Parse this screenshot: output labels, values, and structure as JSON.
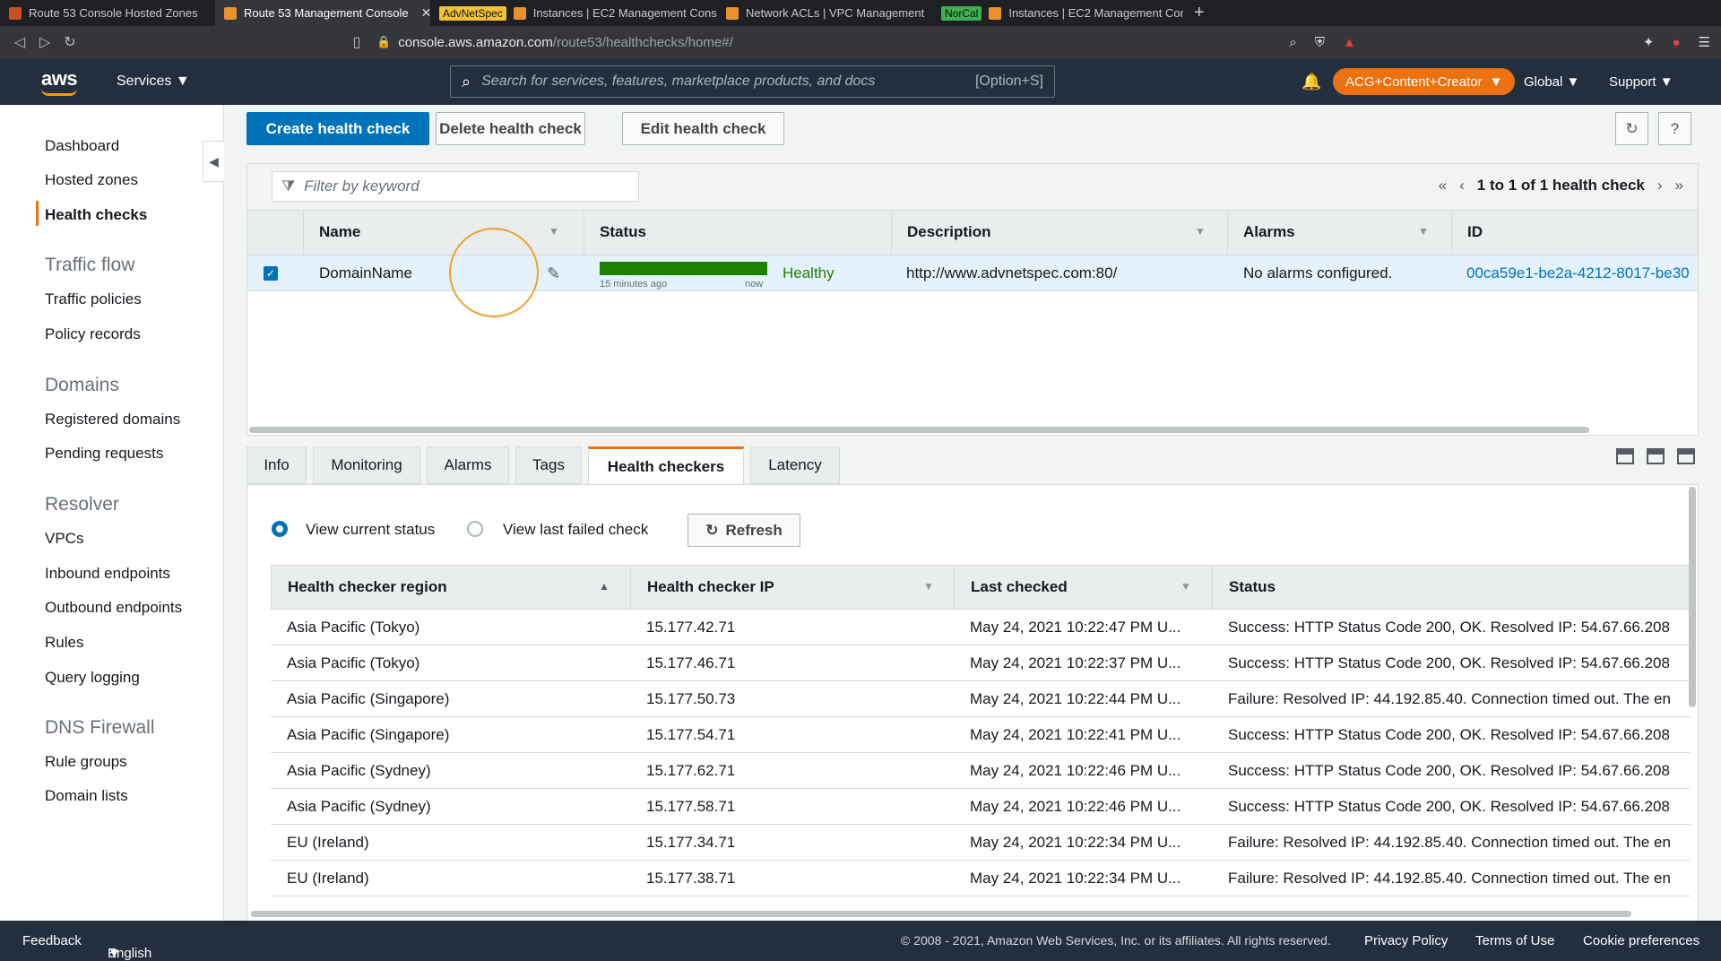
{
  "browser": {
    "tabs": [
      {
        "label": "Route 53 Console Hosted Zones",
        "tag": ""
      },
      {
        "label": "Route 53 Management Console",
        "tag": ""
      },
      {
        "label": "Instances | EC2 Management Cons",
        "tag": "AdvNetSpec"
      },
      {
        "label": "Network ACLs | VPC Management",
        "tag": ""
      },
      {
        "label": "Instances | EC2 Management Cons",
        "tag": "NorCal"
      }
    ],
    "url_host": "console.aws.amazon.com",
    "url_path": "/route53/healthchecks/home#/"
  },
  "awsnav": {
    "logo": "aws",
    "services": "Services",
    "search_placeholder": "Search for services, features, marketplace products, and docs",
    "search_shortcut": "[Option+S]",
    "account": "ACG+Content+Creator",
    "region": "Global",
    "support": "Support"
  },
  "sidebar": {
    "items": [
      "Dashboard",
      "Hosted zones",
      "Health checks"
    ],
    "traffic_flow": {
      "heading": "Traffic flow",
      "items": [
        "Traffic policies",
        "Policy records"
      ]
    },
    "domains": {
      "heading": "Domains",
      "items": [
        "Registered domains",
        "Pending requests"
      ]
    },
    "resolver": {
      "heading": "Resolver",
      "items": [
        "VPCs",
        "Inbound endpoints",
        "Outbound endpoints",
        "Rules",
        "Query logging"
      ]
    },
    "dns_firewall": {
      "heading": "DNS Firewall",
      "items": [
        "Rule groups",
        "Domain lists"
      ]
    }
  },
  "toolbar": {
    "create": "Create health check",
    "delete": "Delete health check",
    "edit": "Edit health check"
  },
  "grid": {
    "filter_placeholder": "Filter by keyword",
    "pager_text": "1 to 1 of 1 health check",
    "columns": [
      "Name",
      "Status",
      "Description",
      "Alarms",
      "ID"
    ],
    "row": {
      "name": "DomainName",
      "status": "Healthy",
      "status_from": "15 minutes ago",
      "status_to": "now",
      "description": "http://www.advnetspec.com:80/",
      "alarms": "No alarms configured.",
      "id": "00ca59e1-be2a-4212-8017-be30"
    }
  },
  "detail_tabs": [
    "Info",
    "Monitoring",
    "Alarms",
    "Tags",
    "Health checkers",
    "Latency"
  ],
  "checkers": {
    "view_current": "View current status",
    "view_failed": "View last failed check",
    "refresh": "Refresh",
    "columns": [
      "Health checker region",
      "Health checker IP",
      "Last checked",
      "Status"
    ],
    "rows": [
      [
        "Asia Pacific (Tokyo)",
        "15.177.42.71",
        "May 24, 2021 10:22:47 PM U...",
        "Success: HTTP Status Code 200, OK. Resolved IP: 54.67.66.208"
      ],
      [
        "Asia Pacific (Tokyo)",
        "15.177.46.71",
        "May 24, 2021 10:22:37 PM U...",
        "Success: HTTP Status Code 200, OK. Resolved IP: 54.67.66.208"
      ],
      [
        "Asia Pacific (Singapore)",
        "15.177.50.73",
        "May 24, 2021 10:22:44 PM U...",
        "Failure: Resolved IP: 44.192.85.40. Connection timed out. The en"
      ],
      [
        "Asia Pacific (Singapore)",
        "15.177.54.71",
        "May 24, 2021 10:22:41 PM U...",
        "Success: HTTP Status Code 200, OK. Resolved IP: 54.67.66.208"
      ],
      [
        "Asia Pacific (Sydney)",
        "15.177.62.71",
        "May 24, 2021 10:22:46 PM U...",
        "Success: HTTP Status Code 200, OK. Resolved IP: 54.67.66.208"
      ],
      [
        "Asia Pacific (Sydney)",
        "15.177.58.71",
        "May 24, 2021 10:22:46 PM U...",
        "Success: HTTP Status Code 200, OK. Resolved IP: 54.67.66.208"
      ],
      [
        "EU (Ireland)",
        "15.177.34.71",
        "May 24, 2021 10:22:34 PM U...",
        "Failure: Resolved IP: 44.192.85.40. Connection timed out. The en"
      ],
      [
        "EU (Ireland)",
        "15.177.38.71",
        "May 24, 2021 10:22:34 PM U...",
        "Failure: Resolved IP: 44.192.85.40. Connection timed out. The en"
      ]
    ]
  },
  "footer": {
    "feedback": "Feedback",
    "language": "English (US)",
    "copyright": "© 2008 - 2021, Amazon Web Services, Inc. or its affiliates. All rights reserved.",
    "privacy": "Privacy Policy",
    "terms": "Terms of Use",
    "cookies": "Cookie preferences"
  },
  "colors": {
    "accent": "#ec7211",
    "primary": "#0073bb",
    "healthy": "#1d8102",
    "nav_bg": "#232f3e"
  }
}
